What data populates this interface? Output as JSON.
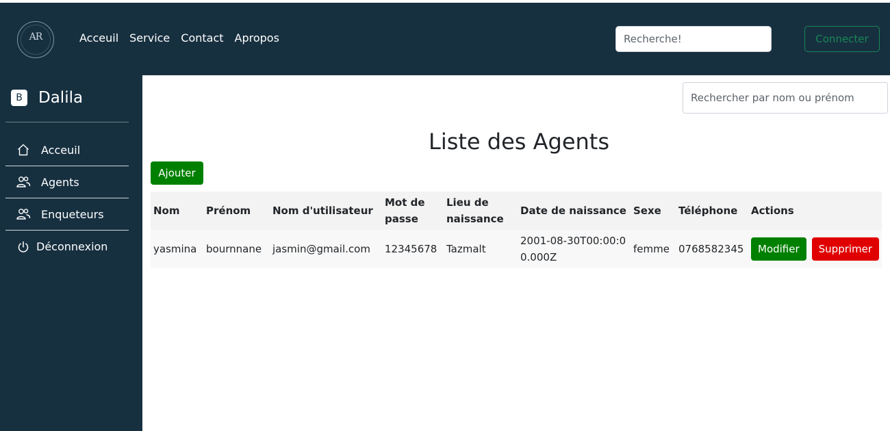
{
  "navbar": {
    "logo_text": "AR",
    "links": [
      "Acceuil",
      "Service",
      "Contact",
      "Apropos"
    ],
    "search_placeholder": "Recherche!",
    "connect_label": "Connecter"
  },
  "sidebar": {
    "brand_badge": "B",
    "brand_name": "Dalila",
    "items": [
      {
        "label": "Acceuil",
        "icon": "home-icon"
      },
      {
        "label": "Agents",
        "icon": "users-icon"
      },
      {
        "label": "Enqueteurs",
        "icon": "users-icon"
      },
      {
        "label": "Déconnexion",
        "icon": "power-icon"
      }
    ]
  },
  "main": {
    "search_placeholder": "Rechercher par nom ou prénom",
    "title": "Liste des Agents",
    "add_label": "Ajouter",
    "table": {
      "headers": [
        "Nom",
        "Prénom",
        "Nom d'utilisateur",
        "Mot de passe",
        "Lieu de naissance",
        "Date de naissance",
        "Sexe",
        "Téléphone",
        "Actions"
      ],
      "rows": [
        {
          "nom": "yasmina",
          "prenom": "bournnane",
          "username": "jasmin@gmail.com",
          "password": "12345678",
          "lieu": "Tazmalt",
          "date": "2001-08-30T00:00:00.000Z",
          "sexe": "femme",
          "telephone": "0768582345",
          "edit_label": "Modifier",
          "delete_label": "Supprimer"
        }
      ]
    }
  },
  "colors": {
    "navy": "#173040",
    "green": "#008000",
    "red": "#e00000",
    "outline_green": "#198754"
  }
}
